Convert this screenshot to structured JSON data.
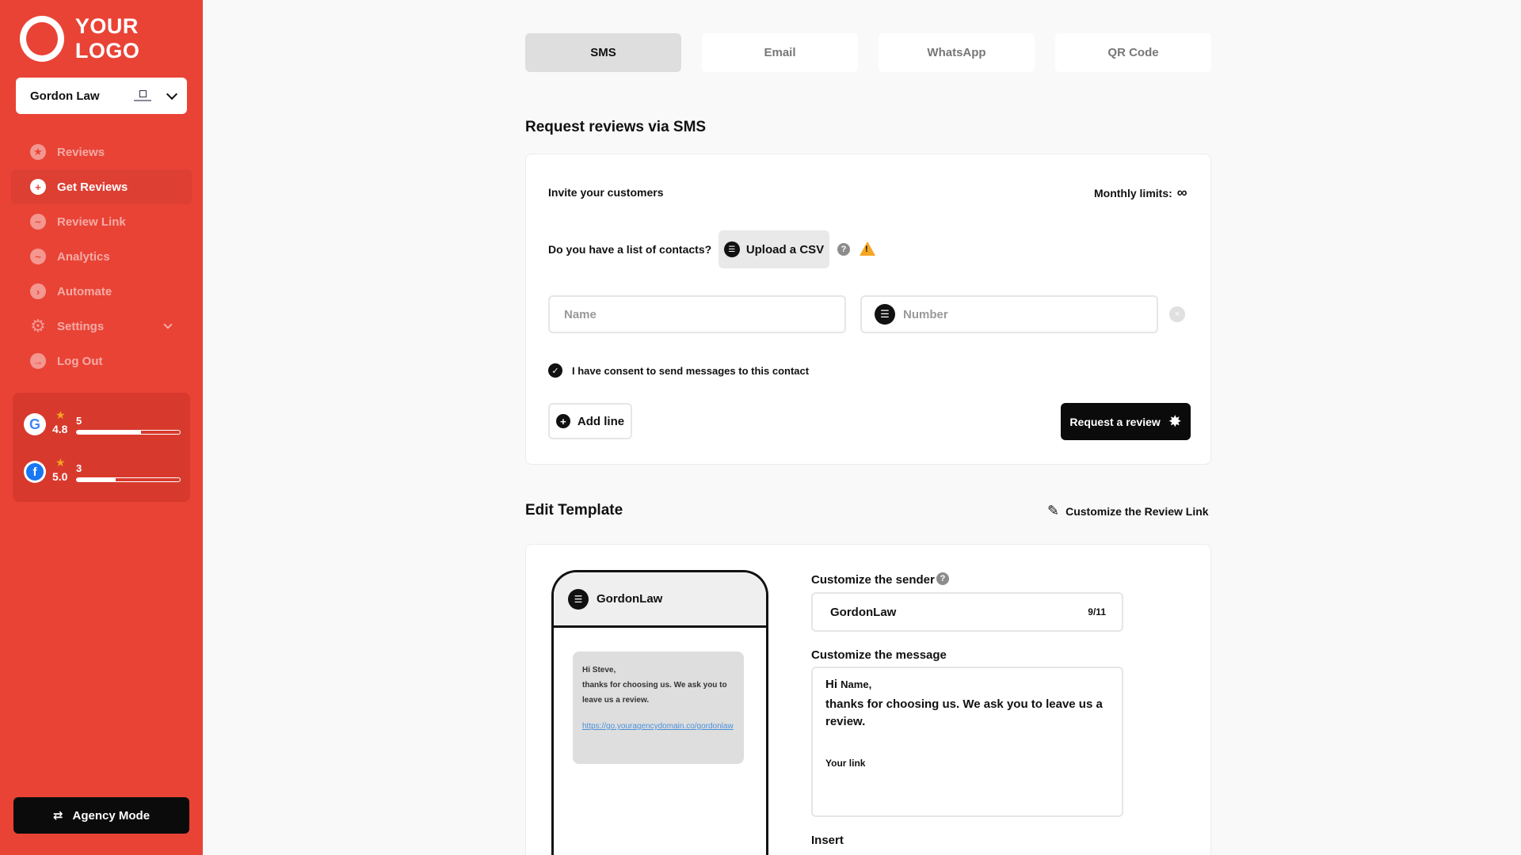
{
  "brand": {
    "logo_text": "YOUR LOGO",
    "accent": "#e94336"
  },
  "account": {
    "name": "Gordon Law"
  },
  "nav": [
    {
      "label": "Reviews",
      "icon": "star-icon"
    },
    {
      "label": "Get Reviews",
      "icon": "plus-icon",
      "active": true
    },
    {
      "label": "Review Link",
      "icon": "link-icon"
    },
    {
      "label": "Analytics",
      "icon": "chart-icon"
    },
    {
      "label": "Automate",
      "icon": "terminal-icon"
    },
    {
      "label": "Settings",
      "icon": "gear-icon"
    },
    {
      "label": "Log Out",
      "icon": "logout-icon"
    }
  ],
  "ratings": {
    "google": {
      "score": "4.8",
      "count": "5",
      "fill": 0.62
    },
    "facebook": {
      "score": "5.0",
      "count": "3",
      "fill": 0.38
    }
  },
  "agency_mode": "Agency Mode",
  "tabs": [
    "SMS",
    "Email",
    "WhatsApp",
    "QR Code"
  ],
  "request": {
    "title": "Request reviews via SMS",
    "invite": "Invite your customers",
    "monthly_limits": "Monthly limits:",
    "contacts_q": "Do you have a list of contacts?",
    "upload_csv": "Upload a CSV",
    "name_placeholder": "Name",
    "number_placeholder": "Number",
    "consent": "I have consent to send messages to this contact",
    "add_line": "Add line",
    "request_btn": "Request a review"
  },
  "template": {
    "title": "Edit Template",
    "customize_link": "Customize the Review Link",
    "phone_sender": "GordonLaw",
    "bubble_greeting": "Hi Steve,",
    "bubble_body": "thanks for choosing us. We ask you to leave us a review.",
    "bubble_link": "https://go.youragencydomain.co/gordonlaw",
    "sender_label": "Customize the sender",
    "sender_value": "GordonLaw",
    "sender_count": "9/11",
    "message_label": "Customize the message",
    "msg_hi": "Hi",
    "msg_name": "Name,",
    "msg_body": "thanks for choosing us. We ask you to leave us a review.",
    "msg_link": "Your link",
    "insert_label": "Insert"
  }
}
